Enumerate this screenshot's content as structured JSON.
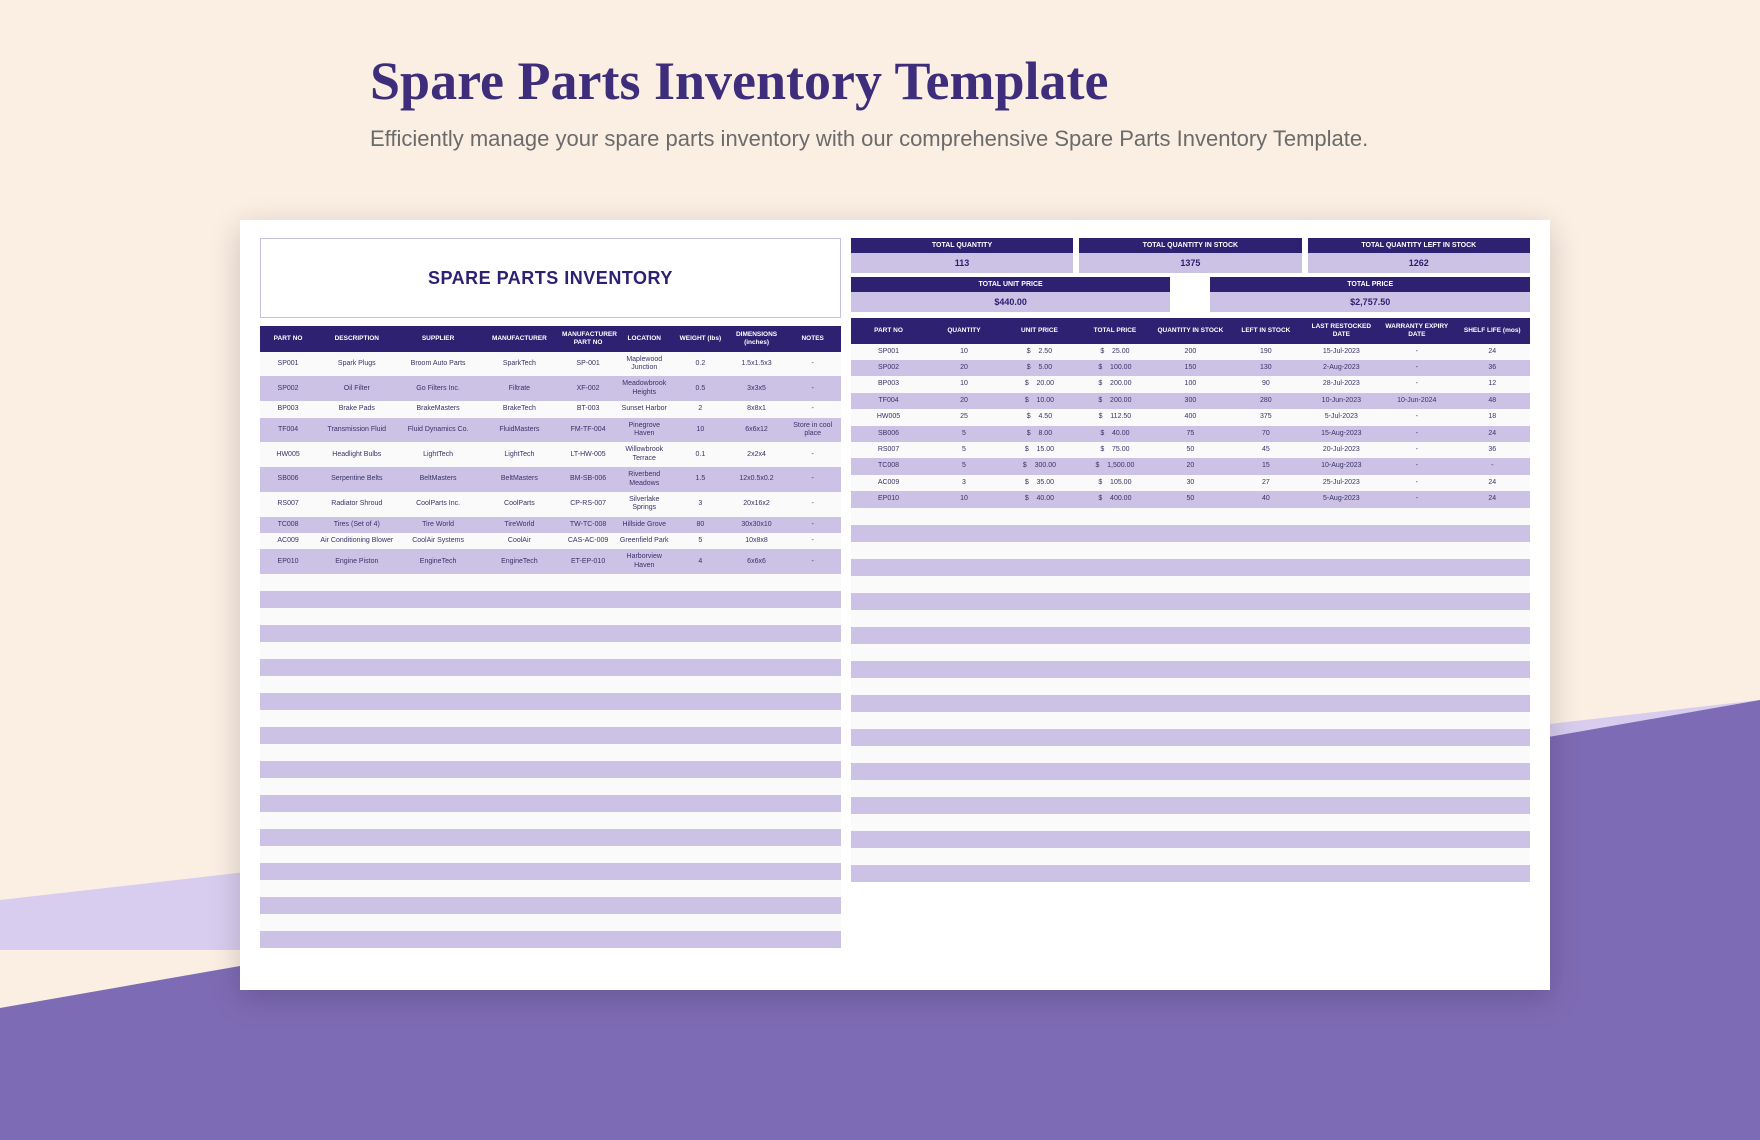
{
  "page": {
    "title": "Spare Parts Inventory Template",
    "subtitle": "Efficiently manage your spare parts inventory with our comprehensive Spare Parts Inventory Template."
  },
  "sheet_title": "SPARE PARTS INVENTORY",
  "summary": {
    "tq_label": "TOTAL QUANTITY",
    "tq_value": "113",
    "tqis_label": "TOTAL QUANTITY IN STOCK",
    "tqis_value": "1375",
    "tqlis_label": "TOTAL QUANTITY LEFT IN STOCK",
    "tqlis_value": "1262",
    "tup_label": "TOTAL UNIT PRICE",
    "tup_value": "$440.00",
    "tp_label": "TOTAL PRICE",
    "tp_value": "$2,757.50"
  },
  "left_headers": [
    "PART NO",
    "DESCRIPTION",
    "SUPPLIER",
    "MANUFACTURER",
    "MANUFACTURER PART NO",
    "LOCATION",
    "WEIGHT (lbs)",
    "DIMENSIONS (inches)",
    "NOTES"
  ],
  "right_headers": [
    "PART NO",
    "QUANTITY",
    "UNIT PRICE",
    "TOTAL PRICE",
    "QUANTITY IN STOCK",
    "LEFT IN STOCK",
    "LAST RESTOCKED DATE",
    "WARRANTY EXPIRY DATE",
    "SHELF LIFE (mos)"
  ],
  "left_rows": [
    [
      "SP001",
      "Spark Plugs",
      "Broom Auto Parts",
      "SparkTech",
      "SP-001",
      "Maplewood Junction",
      "0.2",
      "1.5x1.5x3",
      "-"
    ],
    [
      "SP002",
      "Oil Filter",
      "Go Filters Inc.",
      "Filtrate",
      "XF-002",
      "Meadowbrook Heights",
      "0.5",
      "3x3x5",
      "-"
    ],
    [
      "BP003",
      "Brake Pads",
      "BrakeMasters",
      "BrakeTech",
      "BT-003",
      "Sunset Harbor",
      "2",
      "8x8x1",
      "-"
    ],
    [
      "TF004",
      "Transmission Fluid",
      "Fluid Dynamics Co.",
      "FluidMasters",
      "FM-TF-004",
      "Pinegrove Haven",
      "10",
      "6x6x12",
      "Store in cool place"
    ],
    [
      "HW005",
      "Headlight Bulbs",
      "LightTech",
      "LightTech",
      "LT-HW-005",
      "Willowbrook Terrace",
      "0.1",
      "2x2x4",
      "-"
    ],
    [
      "SB006",
      "Serpentine Belts",
      "BeltMasters",
      "BeltMasters",
      "BM-SB-006",
      "Riverbend Meadows",
      "1.5",
      "12x0.5x0.2",
      "-"
    ],
    [
      "RS007",
      "Radiator Shroud",
      "CoolParts Inc.",
      "CoolParts",
      "CP-RS-007",
      "Silverlake Springs",
      "3",
      "20x16x2",
      "-"
    ],
    [
      "TC008",
      "Tires (Set of 4)",
      "Tire World",
      "TireWorld",
      "TW-TC-008",
      "Hillside Grove",
      "80",
      "30x30x10",
      "-"
    ],
    [
      "AC009",
      "Air Conditioning Blower",
      "CoolAir Systems",
      "CoolAir",
      "CAS-AC-009",
      "Greenfield Park",
      "5",
      "10x8x8",
      "-"
    ],
    [
      "EP010",
      "Engine Piston",
      "EngineTech",
      "EngineTech",
      "ET-EP-010",
      "Harborview Haven",
      "4",
      "6x6x6",
      "-"
    ]
  ],
  "right_rows": [
    [
      "SP001",
      "10",
      "$",
      "2.50",
      "$",
      "25.00",
      "200",
      "190",
      "15-Jul-2023",
      "-",
      "24"
    ],
    [
      "SP002",
      "20",
      "$",
      "5.00",
      "$",
      "100.00",
      "150",
      "130",
      "2-Aug-2023",
      "-",
      "36"
    ],
    [
      "BP003",
      "10",
      "$",
      "20.00",
      "$",
      "200.00",
      "100",
      "90",
      "28-Jul-2023",
      "-",
      "12"
    ],
    [
      "TF004",
      "20",
      "$",
      "10.00",
      "$",
      "200.00",
      "300",
      "280",
      "10-Jun-2023",
      "10-Jun-2024",
      "48"
    ],
    [
      "HW005",
      "25",
      "$",
      "4.50",
      "$",
      "112.50",
      "400",
      "375",
      "5-Jul-2023",
      "-",
      "18"
    ],
    [
      "SB006",
      "5",
      "$",
      "8.00",
      "$",
      "40.00",
      "75",
      "70",
      "15-Aug-2023",
      "-",
      "24"
    ],
    [
      "RS007",
      "5",
      "$",
      "15.00",
      "$",
      "75.00",
      "50",
      "45",
      "20-Jul-2023",
      "-",
      "36"
    ],
    [
      "TC008",
      "5",
      "$",
      "300.00",
      "$",
      "1,500.00",
      "20",
      "15",
      "10-Aug-2023",
      "-",
      "-"
    ],
    [
      "AC009",
      "3",
      "$",
      "35.00",
      "$",
      "105.00",
      "30",
      "27",
      "25-Jul-2023",
      "-",
      "24"
    ],
    [
      "EP010",
      "10",
      "$",
      "40.00",
      "$",
      "400.00",
      "50",
      "40",
      "5-Aug-2023",
      "-",
      "24"
    ]
  ]
}
